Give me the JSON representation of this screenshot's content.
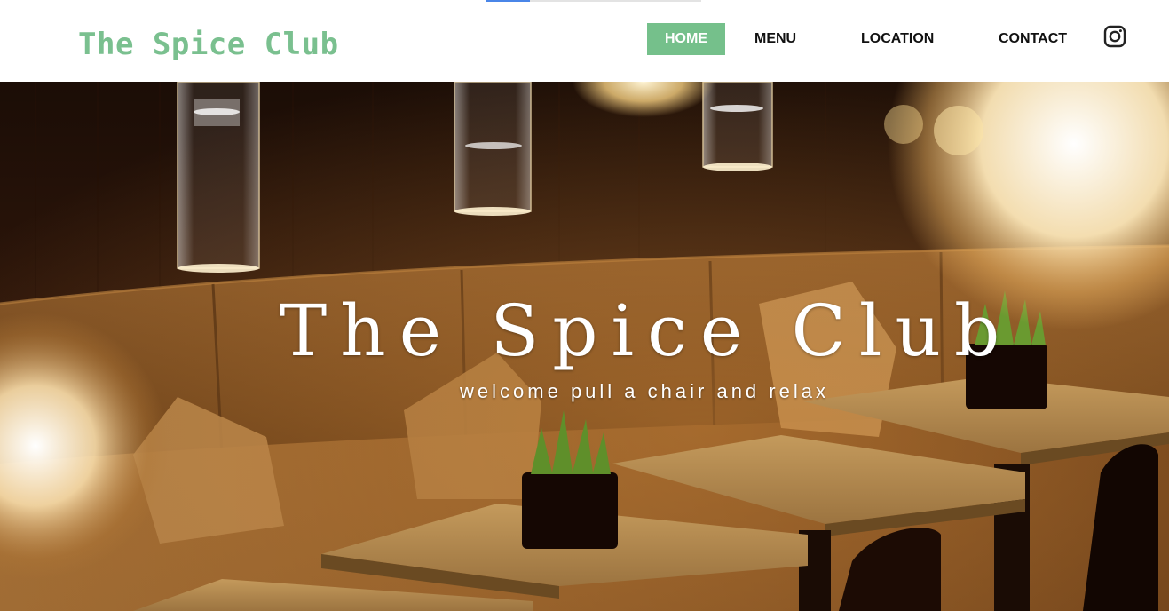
{
  "brand": {
    "name": "The Spice Club",
    "color": "#7ac08f"
  },
  "nav": {
    "active_color": "#75c08b",
    "items": [
      {
        "label": "HOME",
        "active": true
      },
      {
        "label": "MENU",
        "active": false
      },
      {
        "label": "LOCATION",
        "active": false
      },
      {
        "label": "CONTACT",
        "active": false
      }
    ],
    "social_icon": "instagram-icon"
  },
  "hero": {
    "title": "The Spice Club",
    "subtitle": "welcome pull a chair and relax",
    "image": "dim restaurant interior with pendant lights, upholstered booth seating and square tables with potted grass"
  }
}
